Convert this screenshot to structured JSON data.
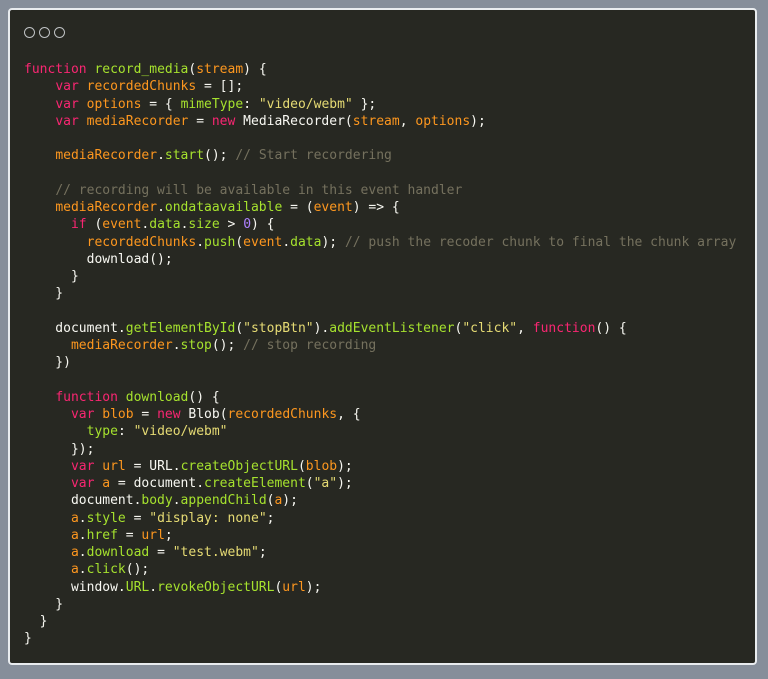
{
  "window": {
    "title": "",
    "controls": [
      "close",
      "minimize",
      "maximize"
    ]
  },
  "editor": {
    "language": "javascript",
    "theme": "monokai",
    "lines": [
      [
        [
          "kw",
          "function"
        ],
        [
          "plain",
          " "
        ],
        [
          "fn",
          "record_media"
        ],
        [
          "plain",
          "("
        ],
        [
          "var",
          "stream"
        ],
        [
          "plain",
          ") {"
        ]
      ],
      [
        [
          "plain",
          "    "
        ],
        [
          "kw",
          "var"
        ],
        [
          "plain",
          " "
        ],
        [
          "var",
          "recordedChunks"
        ],
        [
          "plain",
          " = [];"
        ]
      ],
      [
        [
          "plain",
          "    "
        ],
        [
          "kw",
          "var"
        ],
        [
          "plain",
          " "
        ],
        [
          "var",
          "options"
        ],
        [
          "plain",
          " = { "
        ],
        [
          "fn",
          "mimeType"
        ],
        [
          "plain",
          ": "
        ],
        [
          "str",
          "\"video/webm\""
        ],
        [
          "plain",
          " };"
        ]
      ],
      [
        [
          "plain",
          "    "
        ],
        [
          "kw",
          "var"
        ],
        [
          "plain",
          " "
        ],
        [
          "var",
          "mediaRecorder"
        ],
        [
          "plain",
          " = "
        ],
        [
          "kw",
          "new"
        ],
        [
          "plain",
          " MediaRecorder("
        ],
        [
          "var",
          "stream"
        ],
        [
          "plain",
          ", "
        ],
        [
          "var",
          "options"
        ],
        [
          "plain",
          ");"
        ]
      ],
      [],
      [
        [
          "plain",
          "    "
        ],
        [
          "var",
          "mediaRecorder"
        ],
        [
          "plain",
          "."
        ],
        [
          "fn",
          "start"
        ],
        [
          "plain",
          "(); "
        ],
        [
          "cmt",
          "// Start recordering"
        ]
      ],
      [],
      [
        [
          "plain",
          "    "
        ],
        [
          "cmt",
          "// recording will be available in this event handler"
        ]
      ],
      [
        [
          "plain",
          "    "
        ],
        [
          "var",
          "mediaRecorder"
        ],
        [
          "plain",
          "."
        ],
        [
          "fn",
          "ondataavailable"
        ],
        [
          "plain",
          " = ("
        ],
        [
          "var",
          "event"
        ],
        [
          "plain",
          ") => {"
        ]
      ],
      [
        [
          "plain",
          "      "
        ],
        [
          "kw",
          "if"
        ],
        [
          "plain",
          " ("
        ],
        [
          "var",
          "event"
        ],
        [
          "plain",
          "."
        ],
        [
          "fn",
          "data"
        ],
        [
          "plain",
          "."
        ],
        [
          "fn",
          "size"
        ],
        [
          "plain",
          " > "
        ],
        [
          "num",
          "0"
        ],
        [
          "plain",
          ") {"
        ]
      ],
      [
        [
          "plain",
          "        "
        ],
        [
          "var",
          "recordedChunks"
        ],
        [
          "plain",
          "."
        ],
        [
          "fn",
          "push"
        ],
        [
          "plain",
          "("
        ],
        [
          "var",
          "event"
        ],
        [
          "plain",
          "."
        ],
        [
          "fn",
          "data"
        ],
        [
          "plain",
          "); "
        ],
        [
          "cmt",
          "// push the recoder chunk to final the chunk array"
        ]
      ],
      [
        [
          "plain",
          "        download();"
        ]
      ],
      [
        [
          "plain",
          "      }"
        ]
      ],
      [
        [
          "plain",
          "    }"
        ]
      ],
      [],
      [
        [
          "plain",
          "    document."
        ],
        [
          "fn",
          "getElementById"
        ],
        [
          "plain",
          "("
        ],
        [
          "str",
          "\"stopBtn\""
        ],
        [
          "plain",
          ")."
        ],
        [
          "fn",
          "addEventListener"
        ],
        [
          "plain",
          "("
        ],
        [
          "str",
          "\"click\""
        ],
        [
          "plain",
          ", "
        ],
        [
          "kw",
          "function"
        ],
        [
          "plain",
          "() {"
        ]
      ],
      [
        [
          "plain",
          "      "
        ],
        [
          "var",
          "mediaRecorder"
        ],
        [
          "plain",
          "."
        ],
        [
          "fn",
          "stop"
        ],
        [
          "plain",
          "(); "
        ],
        [
          "cmt",
          "// stop recording"
        ]
      ],
      [
        [
          "plain",
          "    })"
        ]
      ],
      [],
      [
        [
          "plain",
          "    "
        ],
        [
          "kw",
          "function"
        ],
        [
          "plain",
          " "
        ],
        [
          "fn",
          "download"
        ],
        [
          "plain",
          "() {"
        ]
      ],
      [
        [
          "plain",
          "      "
        ],
        [
          "kw",
          "var"
        ],
        [
          "plain",
          " "
        ],
        [
          "var",
          "blob"
        ],
        [
          "plain",
          " = "
        ],
        [
          "kw",
          "new"
        ],
        [
          "plain",
          " Blob("
        ],
        [
          "var",
          "recordedChunks"
        ],
        [
          "plain",
          ", {"
        ]
      ],
      [
        [
          "plain",
          "        "
        ],
        [
          "fn",
          "type"
        ],
        [
          "plain",
          ": "
        ],
        [
          "str",
          "\"video/webm\""
        ]
      ],
      [
        [
          "plain",
          "      });"
        ]
      ],
      [
        [
          "plain",
          "      "
        ],
        [
          "kw",
          "var"
        ],
        [
          "plain",
          " "
        ],
        [
          "var",
          "url"
        ],
        [
          "plain",
          " = URL."
        ],
        [
          "fn",
          "createObjectURL"
        ],
        [
          "plain",
          "("
        ],
        [
          "var",
          "blob"
        ],
        [
          "plain",
          ");"
        ]
      ],
      [
        [
          "plain",
          "      "
        ],
        [
          "kw",
          "var"
        ],
        [
          "plain",
          " "
        ],
        [
          "var",
          "a"
        ],
        [
          "plain",
          " = document."
        ],
        [
          "fn",
          "createElement"
        ],
        [
          "plain",
          "("
        ],
        [
          "str",
          "\"a\""
        ],
        [
          "plain",
          ");"
        ]
      ],
      [
        [
          "plain",
          "      document."
        ],
        [
          "fn",
          "body"
        ],
        [
          "plain",
          "."
        ],
        [
          "fn",
          "appendChild"
        ],
        [
          "plain",
          "("
        ],
        [
          "var",
          "a"
        ],
        [
          "plain",
          ");"
        ]
      ],
      [
        [
          "plain",
          "      "
        ],
        [
          "var",
          "a"
        ],
        [
          "plain",
          "."
        ],
        [
          "fn",
          "style"
        ],
        [
          "plain",
          " = "
        ],
        [
          "str",
          "\"display: none\""
        ],
        [
          "plain",
          ";"
        ]
      ],
      [
        [
          "plain",
          "      "
        ],
        [
          "var",
          "a"
        ],
        [
          "plain",
          "."
        ],
        [
          "fn",
          "href"
        ],
        [
          "plain",
          " = "
        ],
        [
          "var",
          "url"
        ],
        [
          "plain",
          ";"
        ]
      ],
      [
        [
          "plain",
          "      "
        ],
        [
          "var",
          "a"
        ],
        [
          "plain",
          "."
        ],
        [
          "fn",
          "download"
        ],
        [
          "plain",
          " = "
        ],
        [
          "str",
          "\"test.webm\""
        ],
        [
          "plain",
          ";"
        ]
      ],
      [
        [
          "plain",
          "      "
        ],
        [
          "var",
          "a"
        ],
        [
          "plain",
          "."
        ],
        [
          "fn",
          "click"
        ],
        [
          "plain",
          "();"
        ]
      ],
      [
        [
          "plain",
          "      window."
        ],
        [
          "fn",
          "URL"
        ],
        [
          "plain",
          "."
        ],
        [
          "fn",
          "revokeObjectURL"
        ],
        [
          "plain",
          "("
        ],
        [
          "var",
          "url"
        ],
        [
          "plain",
          ");"
        ]
      ],
      [
        [
          "plain",
          "    }"
        ]
      ],
      [
        [
          "plain",
          "  }"
        ]
      ],
      [
        [
          "plain",
          "}"
        ]
      ]
    ]
  }
}
